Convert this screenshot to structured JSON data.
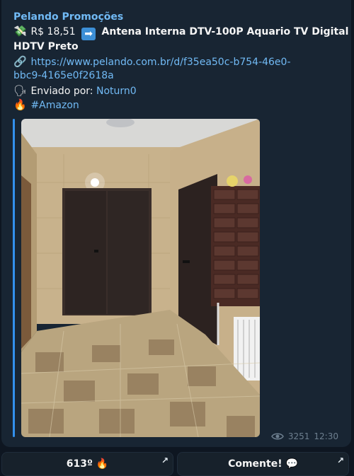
{
  "channel": {
    "name": "Pelando Promoções"
  },
  "post": {
    "money_emoji": "💸",
    "price": "R$ 18,51",
    "arrow_emoji": "➡",
    "title_line1": "Antena Interna DTV-100P Aquario TV Digital",
    "title_line2": "HDTV Preto",
    "link_emoji": "🔗",
    "url_line1": "https://www.pelando.com.br/d/f35ea50c-b754-46e0-",
    "url_line2": "bbc9-4165e0f2618a",
    "sender_emoji": "🗣",
    "sender_label": "Enviado por:",
    "sender_name": "Noturn0",
    "fire_emoji": "🔥",
    "hashtag": "#Amazon"
  },
  "meta": {
    "views": "3251",
    "time": "12:30",
    "eye_icon": "eye-icon"
  },
  "buttons": {
    "temperature": "613º 🔥",
    "comment": "Comente! 💬",
    "corner_glyph": "↗"
  },
  "colors": {
    "link": "#71baf5",
    "background": "#0e1621",
    "bubble": "#182533",
    "accent": "#3390ec"
  }
}
